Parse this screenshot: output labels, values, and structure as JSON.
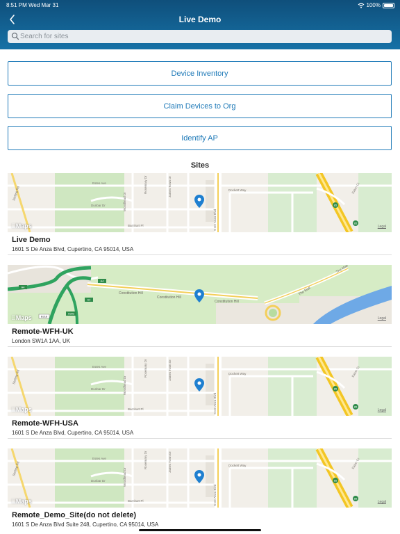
{
  "status_bar": {
    "time": "8:51 PM",
    "date": "Wed Mar 31",
    "battery": "100%"
  },
  "header": {
    "title": "Live Demo"
  },
  "search": {
    "placeholder": "Search for sites"
  },
  "actions": [
    {
      "label": "Device Inventory"
    },
    {
      "label": "Claim Devices to Org"
    },
    {
      "label": "Identify AP"
    }
  ],
  "sites_heading": "Sites",
  "map_attribution": {
    "logo": "Maps",
    "legal": "Legal"
  },
  "map_labels": {
    "cupertino": {
      "street_1": "Estes Ave",
      "street_2": "Stelling Rd",
      "street_3": "Dunbar Dr",
      "street_4": "Barnhart Pl",
      "street_5": "Dockett Way",
      "street_6": "S De Anza Blvd",
      "street_7": "James Town Dr",
      "street_8": "Rosemary Dr",
      "street_9": "Woodhead Dr",
      "street_10": "Eaton Ct",
      "route": "85"
    },
    "london": {
      "road_1": "Constitution Hill",
      "road_2": "The Mall",
      "route_1": "A4",
      "route_2": "A4",
      "route_3": "B318",
      "route_4": "A4",
      "route_5": "A302"
    }
  },
  "sites": [
    {
      "name": "Live Demo",
      "address": "1601 S De Anza Blvd, Cupertino, CA 95014, USA",
      "map": "cupertino"
    },
    {
      "name": "Remote-WFH-UK",
      "address": "London SW1A 1AA, UK",
      "map": "london"
    },
    {
      "name": "Remote-WFH-USA",
      "address": "1601 S De Anza Blvd, Cupertino, CA 95014, USA",
      "map": "cupertino"
    },
    {
      "name": "Remote_Demo_Site(do not delete)",
      "address": "1601 S De Anza Blvd Suite 248, Cupertino, CA 95014, USA",
      "map": "cupertino"
    }
  ]
}
